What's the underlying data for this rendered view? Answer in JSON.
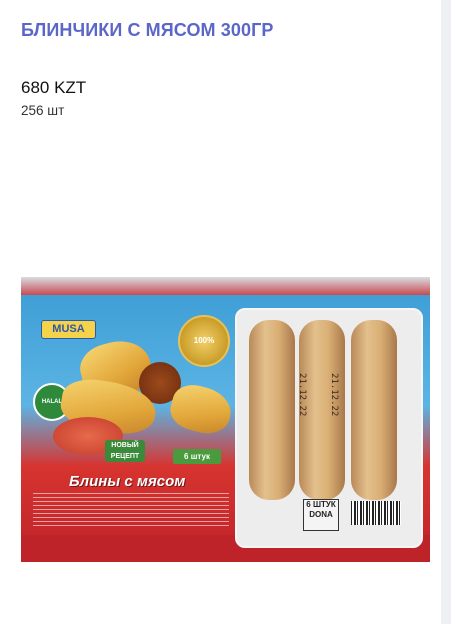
{
  "product": {
    "title": "БЛИНЧИКИ С МЯСОМ 300ГР",
    "price": "680 KZT",
    "stock": "256 шт"
  },
  "image": {
    "brand": "MUSA",
    "name_on_pack": "Блины с мясом",
    "count_badge": "6 штук",
    "new_badge": "НОВЫЙ РЕЦЕПТ",
    "seal": "100%",
    "halal": "HALAL",
    "count_label": "6 ШТУК DONA",
    "date_stamp": "21.12.22"
  },
  "colors": {
    "title": "#5b67c8",
    "package_blue": "#3f9fd6",
    "package_red": "#c9242b"
  }
}
